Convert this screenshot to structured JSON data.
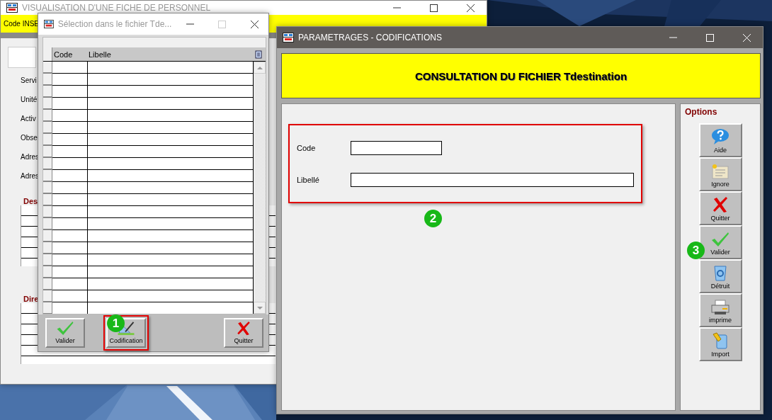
{
  "background_window": {
    "title": "VISUALISATION D'UNE FICHE DE PERSONNEL",
    "header_field": "Code INSE",
    "labels": [
      "Servi",
      "Unité",
      "Activ",
      "Obse",
      "Adres",
      "Adres"
    ],
    "sections": [
      "Des",
      "Dire"
    ]
  },
  "selection_window": {
    "title": "Sélection dans le fichier Tde...",
    "columns": [
      "Code",
      "Libelle"
    ],
    "buttons": [
      {
        "label": "Valider",
        "kind": "valider",
        "highlighted": false
      },
      {
        "label": "Codification",
        "kind": "codification",
        "highlighted": true
      },
      {
        "label": "Quitter",
        "kind": "quitter",
        "highlighted": false
      }
    ]
  },
  "codification_window": {
    "title": "PARAMETRAGES - CODIFICATIONS",
    "heading": "CONSULTATION DU FICHIER Tdestination",
    "form_highlighted": true,
    "fields": [
      {
        "label": "Code",
        "kind": "short"
      },
      {
        "label": "Libellé",
        "kind": "long"
      }
    ],
    "options_title": "Options",
    "options": [
      {
        "label": "Aide",
        "kind": "help"
      },
      {
        "label": "Ignore",
        "kind": "ignore"
      },
      {
        "label": "Quitter",
        "kind": "quitter"
      },
      {
        "label": "Valider",
        "kind": "valider"
      },
      {
        "label": "Détruit",
        "kind": "trash"
      },
      {
        "label": "imprime",
        "kind": "print"
      },
      {
        "label": "Import",
        "kind": "import"
      }
    ]
  },
  "callouts": [
    "1",
    "2",
    "3"
  ]
}
